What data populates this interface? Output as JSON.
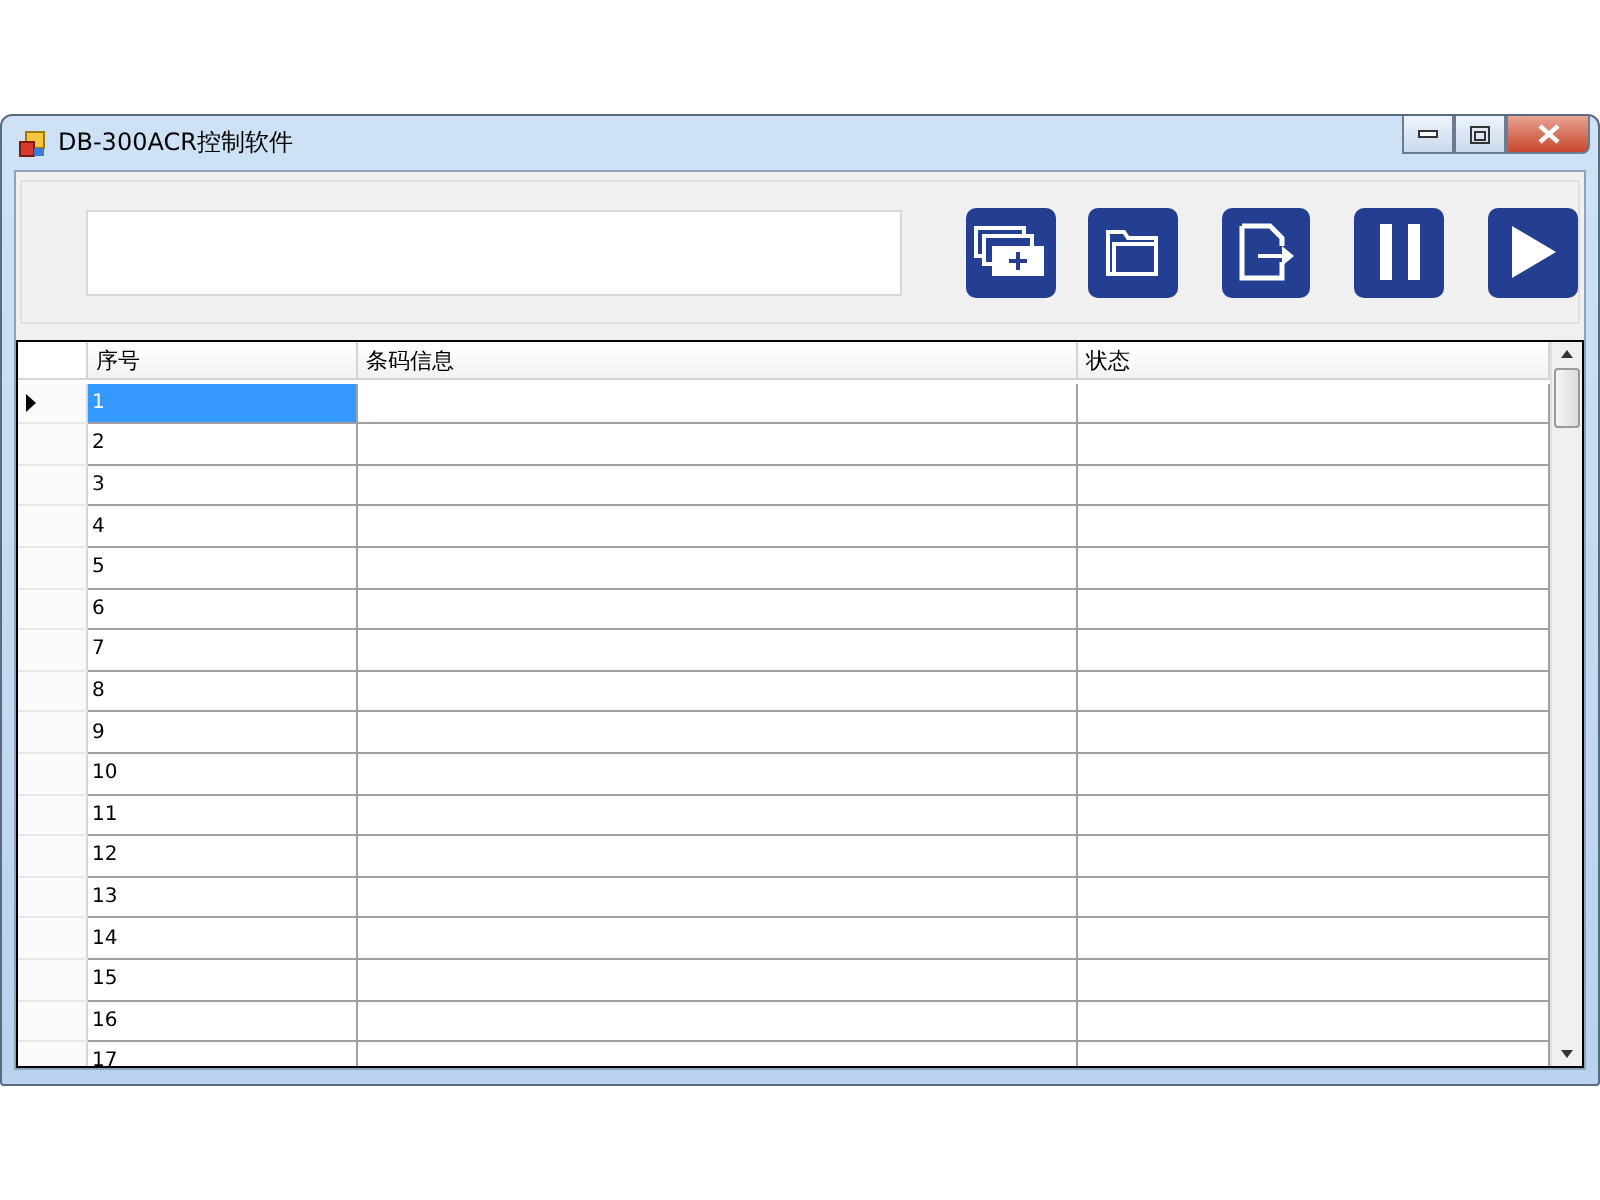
{
  "window": {
    "title": "DB-300ACR控制软件"
  },
  "toolbar": {
    "buttons": [
      {
        "kind": "add"
      },
      {
        "kind": "open"
      },
      {
        "kind": "export"
      },
      {
        "kind": "pause"
      },
      {
        "kind": "play"
      }
    ]
  },
  "table": {
    "columns": [
      "序号",
      "条码信息",
      "状态"
    ],
    "rows": [
      {
        "cells": [
          "1",
          "",
          ""
        ],
        "selected": true
      },
      {
        "cells": [
          "2",
          "",
          ""
        ],
        "selected": false
      },
      {
        "cells": [
          "3",
          "",
          ""
        ],
        "selected": false
      },
      {
        "cells": [
          "4",
          "",
          ""
        ],
        "selected": false
      },
      {
        "cells": [
          "5",
          "",
          ""
        ],
        "selected": false
      },
      {
        "cells": [
          "6",
          "",
          ""
        ],
        "selected": false
      },
      {
        "cells": [
          "7",
          "",
          ""
        ],
        "selected": false
      },
      {
        "cells": [
          "8",
          "",
          ""
        ],
        "selected": false
      },
      {
        "cells": [
          "9",
          "",
          ""
        ],
        "selected": false
      },
      {
        "cells": [
          "10",
          "",
          ""
        ],
        "selected": false
      },
      {
        "cells": [
          "11",
          "",
          ""
        ],
        "selected": false
      },
      {
        "cells": [
          "12",
          "",
          ""
        ],
        "selected": false
      },
      {
        "cells": [
          "13",
          "",
          ""
        ],
        "selected": false
      },
      {
        "cells": [
          "14",
          "",
          ""
        ],
        "selected": false
      },
      {
        "cells": [
          "15",
          "",
          ""
        ],
        "selected": false
      },
      {
        "cells": [
          "16",
          "",
          ""
        ],
        "selected": false
      },
      {
        "cells": [
          "17",
          "",
          ""
        ],
        "selected": false
      }
    ]
  }
}
